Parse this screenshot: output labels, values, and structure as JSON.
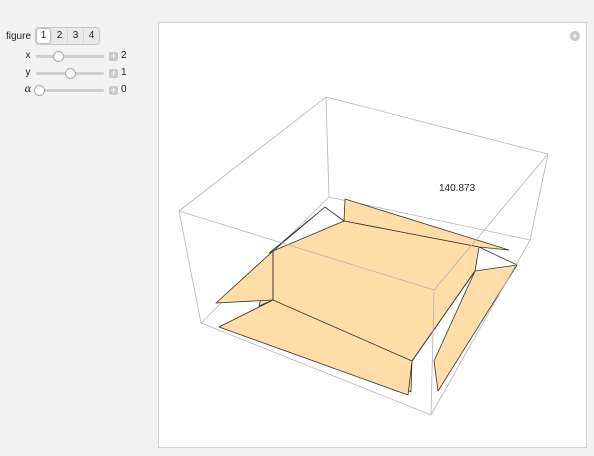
{
  "controls": {
    "figure": {
      "label": "figure",
      "options": [
        "1",
        "2",
        "3",
        "4"
      ],
      "selected": "1"
    },
    "sliders": [
      {
        "label": "x",
        "value": "2",
        "position": 0.33
      },
      {
        "label": "y",
        "value": "1",
        "position": 0.5
      },
      {
        "label": "α",
        "value": "0",
        "position": 0.05
      }
    ],
    "plus_icon": "+"
  },
  "plot": {
    "value_label": "140.873",
    "fill_color": "#FFDCA8",
    "corner_icon": "+"
  }
}
